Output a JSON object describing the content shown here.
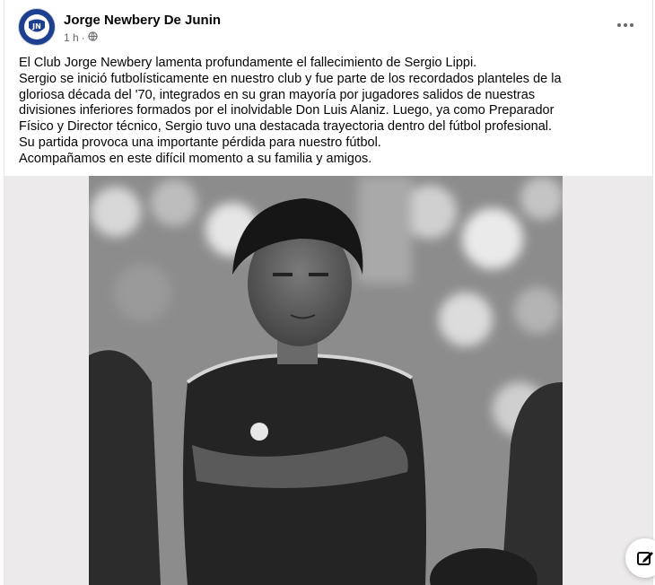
{
  "post": {
    "author": "Jorge Newbery De Junin",
    "timestamp": "1 h",
    "separator": "·",
    "audience_icon": "globe-icon",
    "more_icon": "more-options-icon",
    "text_lines": [
      "El Club Jorge Newbery lamenta profundamente el fallecimiento de Sergio Lippi.",
      "Sergio se inició futbolísticamente en nuestro club y fue parte de los recordados planteles de la",
      "gloriosa década del '70, integrados en su gran mayoría por jugadores salidos de nuestras",
      "divisiones inferiores formados por el inolvidable Don Luis Alaniz. Luego, ya como Preparador",
      "Físico y Director técnico, Sergio tuvo una destacada trayectoria dentro del fútbol profesional.",
      "Su partida provoca una importante pérdida para nuestro fútbol.",
      "Acompañamos en este difícil momento a su familia y amigos."
    ],
    "photo": {
      "description_icon": "vintage-football-player-photo"
    }
  },
  "floating": {
    "icon": "compose-message-icon"
  },
  "colors": {
    "brand_blue": "#1d3f8f",
    "text": "#050505",
    "meta": "#65676b"
  }
}
